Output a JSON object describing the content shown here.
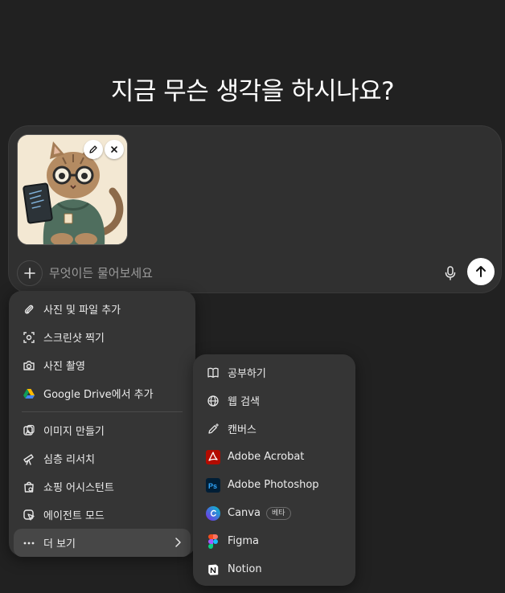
{
  "headline": "지금 무슨 생각을 하시나요?",
  "composer": {
    "placeholder": "무엇이든 물어보세요",
    "attachment": {
      "edit_icon": "pencil-icon",
      "close_icon": "close-icon"
    },
    "plus_icon": "plus-icon",
    "mic_icon": "mic-icon",
    "send_icon": "arrow-up-icon"
  },
  "main_menu": {
    "items": [
      {
        "label": "사진 및 파일 추가",
        "icon": "paperclip-icon"
      },
      {
        "label": "스크린샷 찍기",
        "icon": "screenshot-icon"
      },
      {
        "label": "사진 촬영",
        "icon": "camera-icon"
      },
      {
        "label": "Google Drive에서 추가",
        "icon": "google-drive-icon"
      },
      {
        "label": "이미지 만들기",
        "icon": "image-create-icon"
      },
      {
        "label": "심층 리서치",
        "icon": "telescope-icon"
      },
      {
        "label": "쇼핑 어시스턴트",
        "icon": "shopping-bag-icon"
      },
      {
        "label": "에이전트 모드",
        "icon": "agent-cursor-icon"
      },
      {
        "label": "더 보기",
        "icon": "more-dots-icon"
      }
    ]
  },
  "sub_menu": {
    "items": [
      {
        "label": "공부하기",
        "icon": "book-icon"
      },
      {
        "label": "웹 검색",
        "icon": "globe-icon"
      },
      {
        "label": "캔버스",
        "icon": "pen-sparkle-icon"
      },
      {
        "label": "Adobe Acrobat",
        "icon": "adobe-acrobat-icon"
      },
      {
        "label": "Adobe Photoshop",
        "icon": "adobe-photoshop-icon"
      },
      {
        "label": "Canva",
        "icon": "canva-icon",
        "badge": "베타"
      },
      {
        "label": "Figma",
        "icon": "figma-icon"
      },
      {
        "label": "Notion",
        "icon": "notion-icon"
      }
    ]
  },
  "colors": {
    "background": "#212121",
    "composer": "#303030",
    "menu": "#353535",
    "acrobat": "#b30b00",
    "photoshop": "#001e36",
    "canva": "#7d2ae8"
  }
}
